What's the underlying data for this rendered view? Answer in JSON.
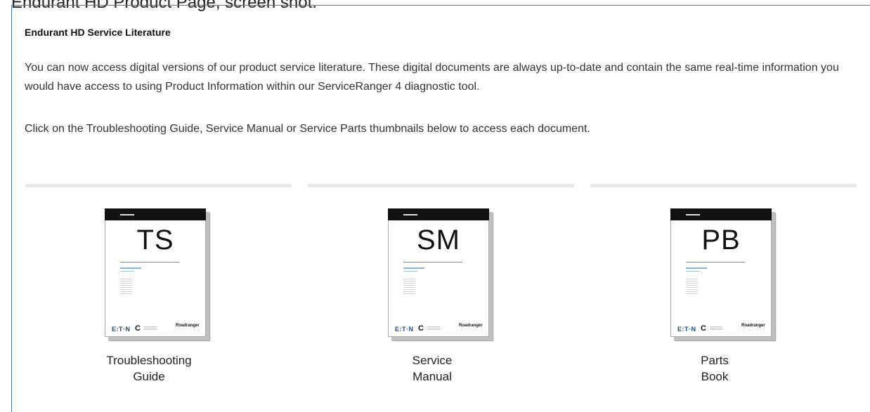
{
  "caption": "Endurant HD Product Page, screen shot.",
  "section": {
    "heading": "Endurant HD Service Literature",
    "paragraph_1": "You can now access digital versions of our product service literature. These digital documents are always up-to-date and contain the same real-time information you would have access to using Product Information within our ServiceRanger 4 diagnostic tool.",
    "paragraph_2": "Click on the Troubleshooting Guide, Service Manual or Service Parts thumbnails below to access each document."
  },
  "documents": [
    {
      "code": "TS",
      "label_line1": "Troubleshooting",
      "label_line2": "Guide"
    },
    {
      "code": "SM",
      "label_line1": "Service",
      "label_line2": "Manual"
    },
    {
      "code": "PB",
      "label_line1": "Parts",
      "label_line2": "Book"
    }
  ],
  "cover_logos": {
    "brand": "E:T·N",
    "roadranger": "Roadranger"
  },
  "colors": {
    "frame_border": "#4a78b5",
    "rule": "#e9e9e9",
    "accent_line": "#4a9ad0"
  }
}
